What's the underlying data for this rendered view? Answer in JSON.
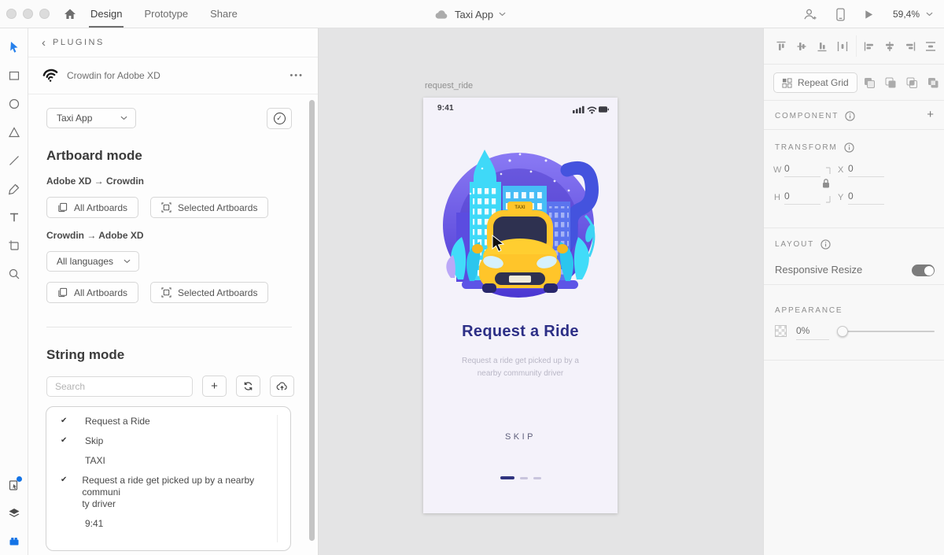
{
  "topbar": {
    "tabs": [
      {
        "label": "Design"
      },
      {
        "label": "Prototype"
      },
      {
        "label": "Share"
      }
    ],
    "document": {
      "title": "Taxi App"
    },
    "zoom": {
      "value": "59,4%"
    }
  },
  "icons": {
    "back": "‹",
    "more": "•••",
    "check_circle": "✓",
    "plus": "+"
  },
  "plugins_panel": {
    "header_label": "PLUGINS",
    "plugin_name": "Crowdin for Adobe XD",
    "project_select": {
      "value": "Taxi App"
    },
    "artboard_mode": {
      "title": "Artboard mode",
      "xd_to_crowdin": "Adobe XD → Crowdin",
      "crowdin_to_xd": "Crowdin → Adobe XD",
      "all_artboards_label": "All Artboards",
      "selected_artboards_label": "Selected Artboards",
      "languages_select": {
        "value": "All languages"
      }
    },
    "string_mode": {
      "title": "String mode",
      "search_placeholder": "Search",
      "strings": [
        {
          "check": "✔",
          "text": "Request a Ride"
        },
        {
          "check": "✔",
          "text": "Skip"
        },
        {
          "check": "",
          "text": "TAXI"
        },
        {
          "check": "✔",
          "text": "Request a ride get picked up by a nearby communi\nty driver"
        },
        {
          "check": "",
          "text": "9:41"
        }
      ]
    }
  },
  "canvas": {
    "artboard_label": "request_ride",
    "screen": {
      "time": "9:41",
      "taxi_sign": "TAXI",
      "title": "Request a Ride",
      "subtitle": "Request a ride get picked up by a\nnearby community driver",
      "skip": "SKIP"
    }
  },
  "inspector": {
    "repeat_grid_label": "Repeat Grid",
    "component": {
      "label": "COMPONENT",
      "add": "+"
    },
    "transform": {
      "label": "TRANSFORM",
      "fields": [
        {
          "label": "W",
          "value": "0"
        },
        {
          "label": "H",
          "value": "0"
        },
        {
          "label": "X",
          "value": "0"
        },
        {
          "label": "Y",
          "value": "0"
        }
      ]
    },
    "layout": {
      "label": "LAYOUT",
      "responsive_resize": "Responsive Resize"
    },
    "appearance": {
      "label": "APPEARANCE",
      "opacity": "0%"
    }
  },
  "colors": {
    "accent_blue": "#1473E6",
    "artboard_title_indigo": "#2D2F86",
    "taxi_yellow": "#FFC62B",
    "illustration_purple": "#5B48DC",
    "illustration_cyan": "#3FD9F8",
    "canvas_gray": "#E4E4E5"
  }
}
